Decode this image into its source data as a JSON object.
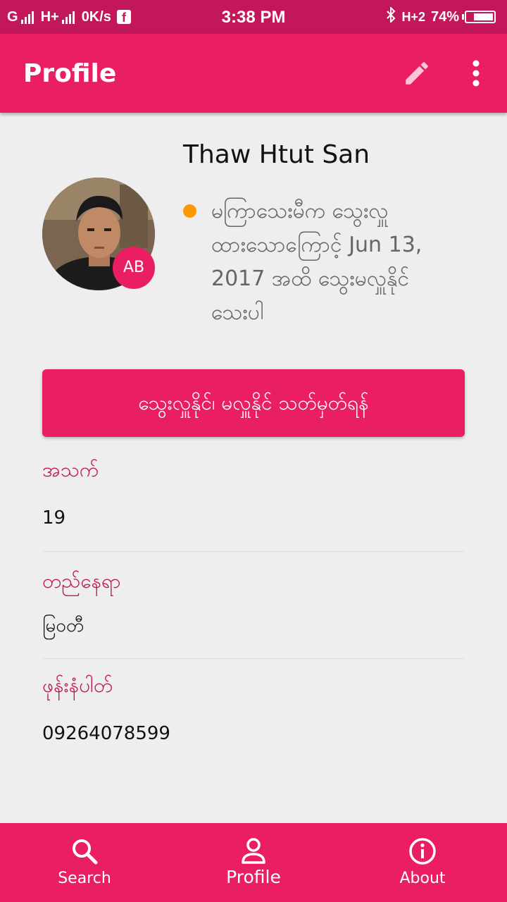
{
  "status_bar": {
    "carrier": "G",
    "network": "H+",
    "speed": "0K/s",
    "time": "3:38 PM",
    "network_right": "H+2",
    "battery": "74%",
    "battery_level": 0.74
  },
  "app_bar": {
    "title": "Profile",
    "edit_icon": "pencil-icon",
    "more_icon": "more-vertical-icon"
  },
  "profile": {
    "name": "Thaw Htut San",
    "initials": "AB",
    "status_color": "#ff9800",
    "status_lines": [
      "မကြာသေးမီက သွေးလှူ",
      "ထားသောကြောင့် Jun 13,",
      "2017 အထိ သွေးမလှူနိုင်",
      "သေးပါ"
    ]
  },
  "action_button": {
    "label": "သွေးလှူနိုင်၊ မလှူနိုင် သတ်မှတ်ရန်"
  },
  "fields": [
    {
      "label": "အသက်",
      "value": "19"
    },
    {
      "label": "တည်နေရာ",
      "value": "မြဝတီ"
    },
    {
      "label": "ဖုန်းနံပါတ်",
      "value": "09264078599"
    }
  ],
  "bottom_nav": {
    "items": [
      {
        "label": "Search",
        "icon": "search-icon"
      },
      {
        "label": "Profile",
        "icon": "person-icon"
      },
      {
        "label": "About",
        "icon": "info-icon"
      }
    ],
    "active": "Profile"
  },
  "colors": {
    "primary": "#e91e63",
    "primary_dark": "#c2185b",
    "background": "#eeeeee",
    "label": "#c2185b",
    "status_dot": "#ff9800"
  }
}
